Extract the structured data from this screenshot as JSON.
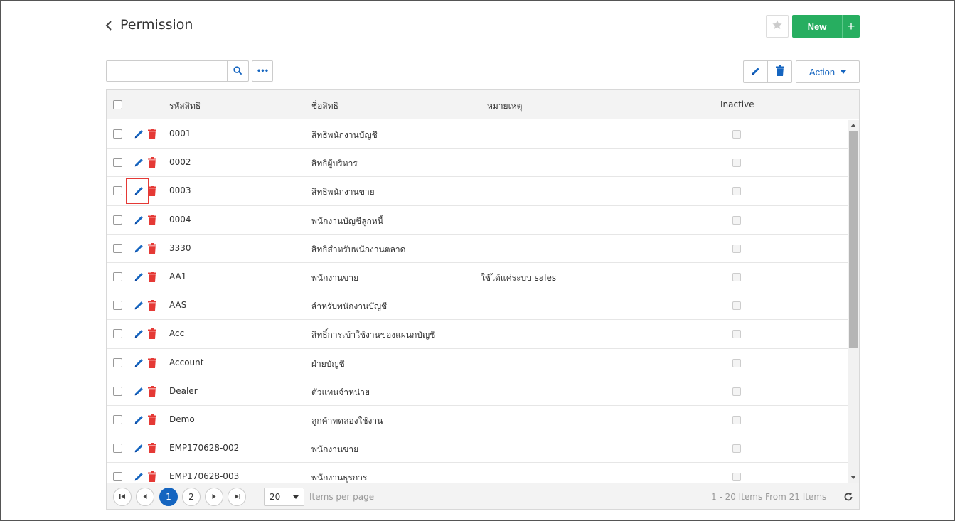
{
  "header": {
    "title": "Permission",
    "new_label": "New",
    "new_plus": "+"
  },
  "toolbar": {
    "search_value": "",
    "more_label": "•••",
    "action_label": "Action"
  },
  "colors": {
    "accent_blue": "#1565c0",
    "green": "#27ae60",
    "delete_red": "#e53935",
    "highlight_red": "#e53935"
  },
  "grid": {
    "columns": {
      "code": "รหัสสิทธิ",
      "name": "ชื่อสิทธิ",
      "note": "หมายเหตุ",
      "inactive": "Inactive"
    },
    "rows": [
      {
        "code": "0001",
        "name": "สิทธิพนักงานบัญชี",
        "note": ""
      },
      {
        "code": "0002",
        "name": "สิทธิผู้บริหาร",
        "note": ""
      },
      {
        "code": "0003",
        "name": "สิทธิพนักงานขาย",
        "note": ""
      },
      {
        "code": "0004",
        "name": "พนักงานบัญชีลูกหนี้",
        "note": ""
      },
      {
        "code": "3330",
        "name": "สิทธิสำหรับพนักงานตลาด",
        "note": ""
      },
      {
        "code": "AA1",
        "name": "พนักงานขาย",
        "note": "ใช้ได้แค่ระบบ sales"
      },
      {
        "code": "AAS",
        "name": "สำหรับพนักงานบัญชี",
        "note": ""
      },
      {
        "code": "Acc",
        "name": "สิทธิ์การเข้าใช้งานของแผนกบัญชี",
        "note": ""
      },
      {
        "code": "Account",
        "name": "ฝ่ายบัญชี",
        "note": ""
      },
      {
        "code": "Dealer",
        "name": "ตัวแทนจำหน่าย",
        "note": ""
      },
      {
        "code": "Demo",
        "name": "ลูกค้าทดลองใช้งาน",
        "note": ""
      },
      {
        "code": "EMP170628-002",
        "name": "พนักงานขาย",
        "note": ""
      },
      {
        "code": "EMP170628-003",
        "name": "พนักงานธุรการ",
        "note": ""
      }
    ]
  },
  "pager": {
    "pages": [
      "1",
      "2"
    ],
    "current_page": "1",
    "page_size": "20",
    "items_per_page_label": "Items per page",
    "range_label": "1 - 20 Items From 21 Items"
  }
}
